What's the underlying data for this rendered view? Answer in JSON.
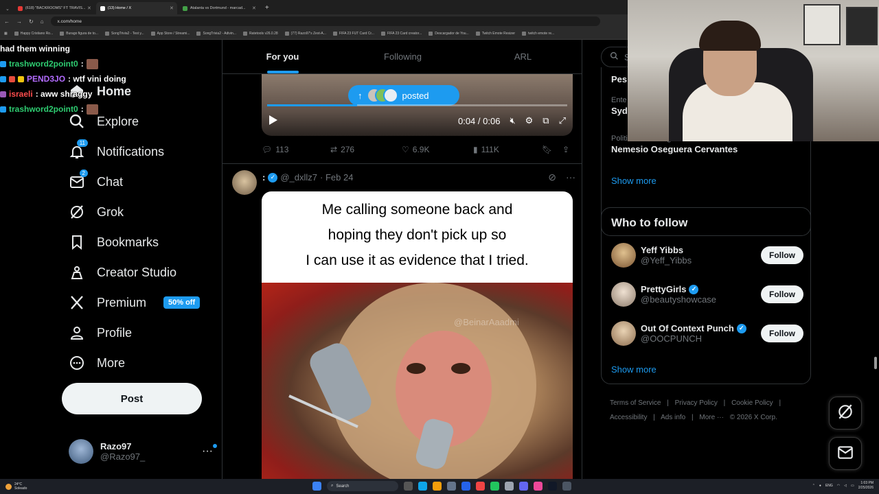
{
  "browser": {
    "tabs": [
      {
        "label": "(618) \"BACKROOMS\" FT TRAVIS...",
        "color": "#e53935",
        "active": false
      },
      {
        "label": "(13) Home / X",
        "color": "#ffffff",
        "active": true
      },
      {
        "label": "Atalanta vs Dortmund - marcad...",
        "color": "#43a047",
        "active": false
      }
    ],
    "url": "x.com/home",
    "bookmarks": [
      "Happy Cristiano Ro...",
      "Burago figura de to...",
      "SongTrivia2 - Test y...",
      "App Store / Streami...",
      "SongTrivia2 - Adivin...",
      "Ratetools v26.0.28",
      "(77) Razo97's Zest-A...",
      "FIFA 23 FUT Card Cr...",
      "FIFA 23 Card creator...",
      "Descargador de You...",
      "Twitch Emote Resizer",
      "twitch emote re..."
    ]
  },
  "chat": {
    "lines": [
      {
        "user": "",
        "text": "had them winning",
        "user_color": "#ffffff",
        "emote": false
      },
      {
        "user": "trashword2point0",
        "text": ":",
        "user_color": "#2ecc71",
        "emote": true
      },
      {
        "user": "PEND3JO",
        "text": ": wtf vini doing",
        "user_color": "#b36cff",
        "emote": false
      },
      {
        "user": "israeli",
        "text": ": aww shraggy",
        "user_color": "#ff4d4d",
        "emote": false
      },
      {
        "user": "trashword2point0",
        "text": ":",
        "user_color": "#2ecc71",
        "emote": true
      }
    ]
  },
  "sidebar": {
    "items": [
      {
        "key": "home",
        "label": "Home",
        "icon": "home-icon",
        "badge": ""
      },
      {
        "key": "explore",
        "label": "Explore",
        "icon": "search-icon",
        "badge": ""
      },
      {
        "key": "notifications",
        "label": "Notifications",
        "icon": "bell-icon",
        "badge": "11"
      },
      {
        "key": "chat",
        "label": "Chat",
        "icon": "mail-icon",
        "badge": "2"
      },
      {
        "key": "grok",
        "label": "Grok",
        "icon": "grok-icon",
        "badge": ""
      },
      {
        "key": "bookmarks",
        "label": "Bookmarks",
        "icon": "bookmark-icon",
        "badge": ""
      },
      {
        "key": "creator-studio",
        "label": "Creator Studio",
        "icon": "creator-studio-icon",
        "badge": ""
      },
      {
        "key": "premium",
        "label": "Premium",
        "icon": "x-logo-icon",
        "badge": ""
      },
      {
        "key": "profile",
        "label": "Profile",
        "icon": "person-icon",
        "badge": ""
      },
      {
        "key": "more",
        "label": "More",
        "icon": "more-circle-icon",
        "badge": ""
      }
    ],
    "premium_pill": "50% off",
    "post_label": "Post",
    "account": {
      "name": "Razo97",
      "handle": "@Razo97_"
    }
  },
  "timeline": {
    "tabs": [
      "For you",
      "Following",
      "ARL"
    ],
    "active_tab": "For you",
    "video": {
      "posted_label": "posted",
      "time": "0:04 / 0:06",
      "progress_fraction": 0.3
    },
    "actions": {
      "replies": "113",
      "reposts": "276",
      "likes": "6.9K",
      "views": "111K"
    },
    "tweet": {
      "name": ":",
      "handle": "@_dxllz7",
      "date": "· Feb 24",
      "meme_text_lines": [
        "Me calling someone back and",
        "hoping they don't pick up so",
        "I can use it as evidence that I tried."
      ],
      "watermark": "@BeinarAaadmi"
    }
  },
  "right": {
    "search_placeholder": "Se",
    "trends": [
      {
        "context": "",
        "title": "Pes"
      },
      {
        "context": "Ente",
        "title": "Sydn"
      },
      {
        "context": "Politics · Trending",
        "title": "Nemesio Oseguera Cervantes"
      }
    ],
    "show_more": "Show more",
    "who_to_follow": {
      "title": "Who to follow",
      "people": [
        {
          "name": "Yeff Yibbs",
          "handle": "@Yeff_Yibbs",
          "verified": false
        },
        {
          "name": "PrettyGirls",
          "handle": "@beautyshowcase",
          "verified": true
        },
        {
          "name": "Out Of Context Punch",
          "handle": "@OOCPUNCH",
          "verified": true
        }
      ],
      "follow_label": "Follow",
      "show_more": "Show more"
    },
    "footer": {
      "row1": [
        "Terms of Service",
        "|",
        "Privacy Policy",
        "|",
        "Cookie Policy",
        "|"
      ],
      "row2": [
        "Accessibility",
        "|",
        "Ads info",
        "|",
        "More ···",
        "© 2026 X Corp."
      ]
    }
  },
  "taskbar": {
    "weather_temp": "24°C",
    "weather_desc": "Soleado",
    "search_label": "Search",
    "lang": "ENG",
    "time": "1:03 PM",
    "date": "2/25/2026"
  },
  "colors": {
    "accent": "#1d9bf0",
    "background": "#000000",
    "text": "#e7e9ea",
    "muted": "#71767b",
    "border": "#2f3336"
  }
}
